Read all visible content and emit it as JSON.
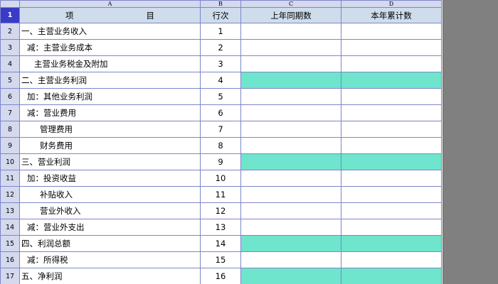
{
  "columns": {
    "row_header": "",
    "A": "A",
    "B": "B",
    "C": "C",
    "D": "D"
  },
  "header_row": {
    "row_num": "1",
    "item_left": "项",
    "item_right": "目",
    "seq": "行次",
    "prior": "上年同期数",
    "current": "本年累计数"
  },
  "rows": [
    {
      "row_num": "2",
      "label": "一、主营业务收入",
      "indent": 0,
      "seq": "1",
      "highlight": false
    },
    {
      "row_num": "3",
      "label": "减：主营业务成本",
      "indent": 1,
      "seq": "2",
      "highlight": false
    },
    {
      "row_num": "4",
      "label": "主营业务税金及附加",
      "indent": 2,
      "seq": "3",
      "highlight": false
    },
    {
      "row_num": "5",
      "label": "二、主营业务利润",
      "indent": 0,
      "seq": "4",
      "highlight": true
    },
    {
      "row_num": "6",
      "label": "加：其他业务利润",
      "indent": 1,
      "seq": "5",
      "highlight": false
    },
    {
      "row_num": "7",
      "label": "减：营业费用",
      "indent": 1,
      "seq": "6",
      "highlight": false
    },
    {
      "row_num": "8",
      "label": "管理费用",
      "indent": 3,
      "seq": "7",
      "highlight": false
    },
    {
      "row_num": "9",
      "label": "财务费用",
      "indent": 3,
      "seq": "8",
      "highlight": false
    },
    {
      "row_num": "10",
      "label": "三、营业利润",
      "indent": 0,
      "seq": "9",
      "highlight": true
    },
    {
      "row_num": "11",
      "label": "加：投资收益",
      "indent": 1,
      "seq": "10",
      "highlight": false
    },
    {
      "row_num": "12",
      "label": "补贴收入",
      "indent": 3,
      "seq": "11",
      "highlight": false
    },
    {
      "row_num": "13",
      "label": "营业外收入",
      "indent": 3,
      "seq": "12",
      "highlight": false
    },
    {
      "row_num": "14",
      "label": "减：营业外支出",
      "indent": 1,
      "seq": "13",
      "highlight": false
    },
    {
      "row_num": "15",
      "label": "四、利润总额",
      "indent": 0,
      "seq": "14",
      "highlight": true
    },
    {
      "row_num": "16",
      "label": "减：所得税",
      "indent": 1,
      "seq": "15",
      "highlight": false
    },
    {
      "row_num": "17",
      "label": "五、净利润",
      "indent": 0,
      "seq": "16",
      "highlight": true
    }
  ],
  "colors": {
    "highlight": "#6ee5cc",
    "header_bg": "#cfdcec",
    "gridline": "#7d86c9",
    "selected_row_header": "#3a3ac8"
  }
}
